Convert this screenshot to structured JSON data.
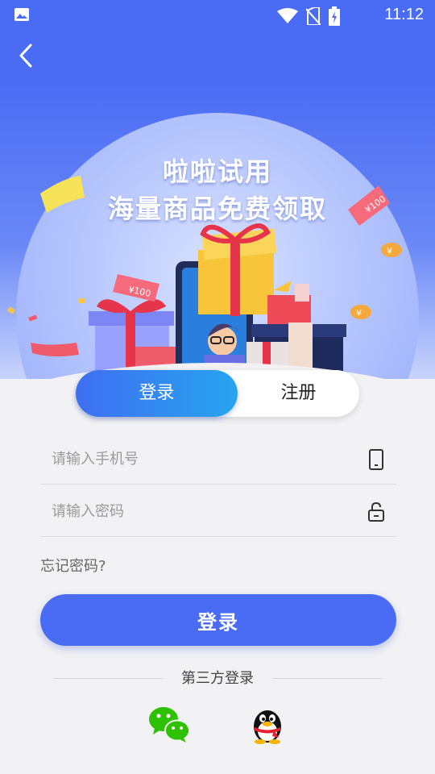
{
  "status_bar": {
    "time": "11:12"
  },
  "hero": {
    "title_line1": "啦啦试用",
    "title_line2": "海量商品免费领取",
    "coupon_text": "¥100",
    "coin_symbol": "¥"
  },
  "tabs": [
    {
      "label": "登录",
      "active": true
    },
    {
      "label": "注册",
      "active": false
    }
  ],
  "form": {
    "phone_placeholder": "请输入手机号",
    "password_placeholder": "请输入密码",
    "forgot_label": "忘记密码?",
    "submit_label": "登录"
  },
  "third_party": {
    "label": "第三方登录",
    "providers": [
      "wechat",
      "qq"
    ]
  },
  "colors": {
    "primary": "#4a6cf4",
    "tab_gradient_start": "#3f6ef2",
    "tab_gradient_end": "#27a5ef",
    "wechat": "#2dc100"
  }
}
